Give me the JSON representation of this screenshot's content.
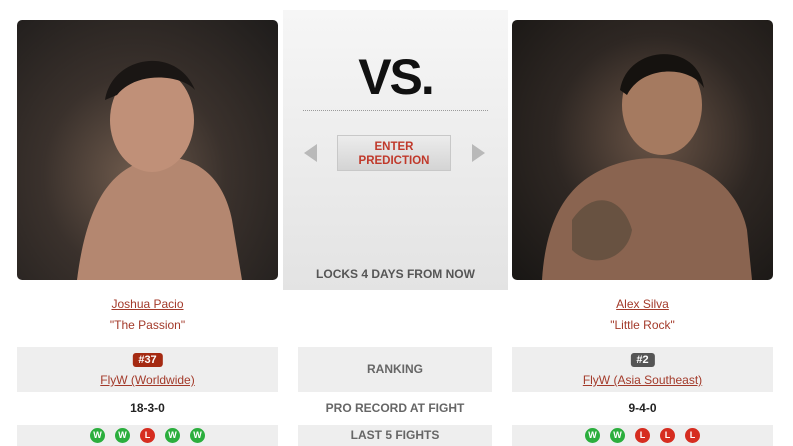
{
  "matchup": {
    "vs_text": "VS.",
    "enter_prediction": "ENTER\nPREDICTION",
    "locks_text": "LOCKS 4 DAYS FROM NOW"
  },
  "labels": {
    "ranking": "RANKING",
    "pro_record": "PRO RECORD AT FIGHT",
    "last5": "LAST 5 FIGHTS"
  },
  "fighters": [
    {
      "name": "Joshua Pacio",
      "nickname": "\"The Passion\"",
      "rank": "#37",
      "division": "FlyW (Worldwide)",
      "record": "18-3-0",
      "last5": [
        "W",
        "W",
        "L",
        "W",
        "W"
      ]
    },
    {
      "name": "Alex Silva",
      "nickname": "\"Little Rock\"",
      "rank": "#2",
      "division": "FlyW (Asia Southeast)",
      "record": "9-4-0",
      "last5": [
        "W",
        "W",
        "L",
        "L",
        "L"
      ]
    }
  ],
  "colors": {
    "win": "#2bae3d",
    "loss": "#d62d20",
    "link": "#a33a2a",
    "rank_badge_left": "#a52a12",
    "rank_badge_right": "#555555"
  }
}
